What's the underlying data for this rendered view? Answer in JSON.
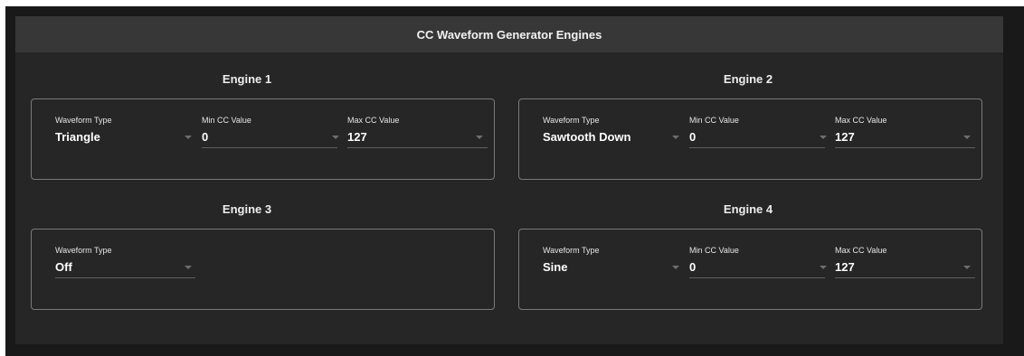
{
  "header": {
    "title": "CC Waveform Generator Engines"
  },
  "engines": [
    {
      "title": "Engine 1",
      "fields": [
        {
          "label": "Waveform Type",
          "value": "Triangle"
        },
        {
          "label": "Min CC Value",
          "value": "0"
        },
        {
          "label": "Max CC Value",
          "value": "127"
        }
      ]
    },
    {
      "title": "Engine 2",
      "fields": [
        {
          "label": "Waveform Type",
          "value": "Sawtooth Down"
        },
        {
          "label": "Min CC Value",
          "value": "0"
        },
        {
          "label": "Max CC Value",
          "value": "127"
        }
      ]
    },
    {
      "title": "Engine 3",
      "fields": [
        {
          "label": "Waveform Type",
          "value": "Off"
        }
      ]
    },
    {
      "title": "Engine 4",
      "fields": [
        {
          "label": "Waveform Type",
          "value": "Sine"
        },
        {
          "label": "Min CC Value",
          "value": "0"
        },
        {
          "label": "Max CC Value",
          "value": "127"
        }
      ]
    }
  ],
  "colors": {
    "background": "#191919",
    "panel": "#262626",
    "header": "#373737",
    "border": "#7a7a7a"
  }
}
